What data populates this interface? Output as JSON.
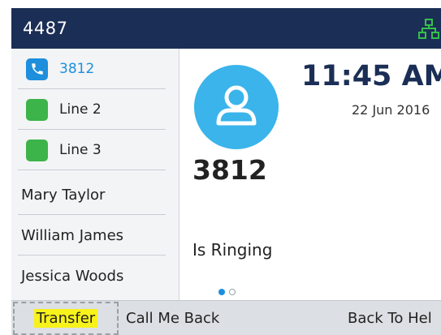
{
  "status_bar": {
    "extension": "4487"
  },
  "sidebar": {
    "lines": [
      {
        "label": "3812",
        "state": "active"
      },
      {
        "label": "Line 2",
        "state": "idle"
      },
      {
        "label": "Line 3",
        "state": "idle"
      }
    ],
    "contacts": [
      {
        "label": "Mary Taylor"
      },
      {
        "label": "William James"
      },
      {
        "label": "Jessica Woods"
      }
    ]
  },
  "call": {
    "number": "3812",
    "state": "Is Ringing"
  },
  "clock": {
    "time": "11:45 AM",
    "date": "22 Jun 2016"
  },
  "softkeys": {
    "transfer": "Transfer",
    "call_me_back": "Call Me Back",
    "back_to_held": "Back To Hel"
  },
  "colors": {
    "status_bar": "#1b2e55",
    "active_line": "#1d8fdc",
    "idle_line": "#3cb44a",
    "avatar": "#3ab4ea",
    "highlight": "#f8f21c"
  },
  "icons": {
    "network": "network-icon",
    "phone": "phone-handset-icon",
    "person": "person-icon"
  }
}
